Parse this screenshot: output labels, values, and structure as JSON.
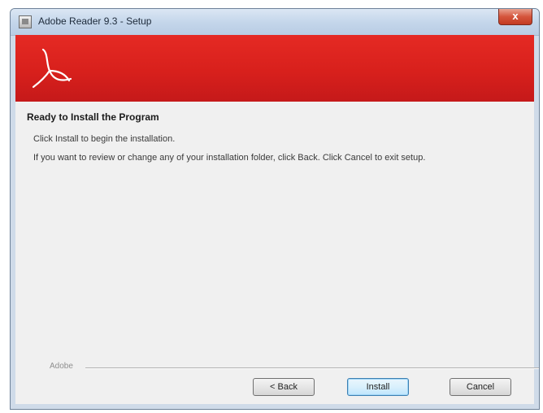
{
  "window": {
    "title": "Adobe Reader 9.3 - Setup",
    "close_label": "x"
  },
  "banner": {
    "logo": "adobe-reader-logo",
    "accent_color": "#d8201c"
  },
  "main": {
    "heading": "Ready to Install the Program",
    "line1": "Click Install to begin the installation.",
    "line2": "If you want to review or change any of your installation folder, click Back. Click Cancel to exit setup."
  },
  "footer": {
    "vendor": "Adobe",
    "back_label": "< Back",
    "install_label": "Install",
    "cancel_label": "Cancel"
  }
}
